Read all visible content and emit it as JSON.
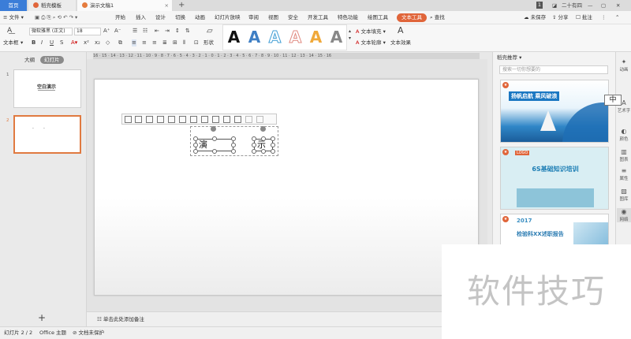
{
  "titlebar": {
    "tabs": [
      {
        "label": "首页"
      },
      {
        "label": "稻壳模板"
      },
      {
        "label": "演示文稿1"
      }
    ],
    "user_name": "二十有四",
    "page_badge": "1",
    "new_tab": "+"
  },
  "menubar": {
    "file": "文件",
    "items": [
      "开始",
      "插入",
      "设计",
      "切换",
      "动画",
      "幻灯片放映",
      "审阅",
      "视图",
      "安全",
      "开发工具",
      "特色功能",
      "绘图工具",
      "文本工具"
    ],
    "search": "查找",
    "unsaved": "未保存",
    "share": "分享",
    "annotate": "批注"
  },
  "ribbon": {
    "textbox": "文本框",
    "shape": "形状",
    "font_name": "微软雅黑 (正文)",
    "font_size": "18",
    "text_fill": "文本填充",
    "text_outline": "文本轮廓",
    "text_effect": "文本效果",
    "gallery_glyph": "A"
  },
  "ruler": {
    "text": "16 · 15 · 14 · 13 · 12 · 11 · 10 · 9 · 8 · 7 · 6 · 5 · 4 · 3 · 2 · 1 · 0 · 1 · 2 · 3 · 4 · 5 · 6 · 7 · 8 · 9 · 10 · 11 · 12 · 13 · 14 · 15 · 16"
  },
  "leftpanel": {
    "tab_outline": "大纲",
    "tab_slides": "幻灯片",
    "slides": [
      {
        "number": "1",
        "title": "空白演示"
      },
      {
        "number": "2",
        "title": ""
      }
    ],
    "add": "+"
  },
  "slide": {
    "textbox_1": "演",
    "textbox_2": "示"
  },
  "notes": {
    "placeholder": "单击此处添加备注"
  },
  "status": {
    "slide_count": "幻灯片 2 / 2",
    "theme": "Office 主题",
    "protect": "文档未保护"
  },
  "rpanel": {
    "title": "稻壳推荐",
    "search_placeholder": "搜索一切你想要的",
    "templates": [
      {
        "title": "扬帆启航 乘风破浪",
        "tag": ""
      },
      {
        "title": "6S基础知识培训",
        "tag": "LOGO"
      },
      {
        "title": "检验科XX述职报告",
        "tag": "2017"
      }
    ]
  },
  "rside": {
    "items": [
      "动画",
      "艺术字",
      "颜色",
      "图表",
      "属性",
      "图库",
      "网络"
    ],
    "ime": "中"
  },
  "watermark": {
    "text": "软件技巧"
  },
  "colors": {
    "accent": "#e0653a",
    "home_tab": "#3b7dd8",
    "selected_thumb": "#e07a40"
  }
}
